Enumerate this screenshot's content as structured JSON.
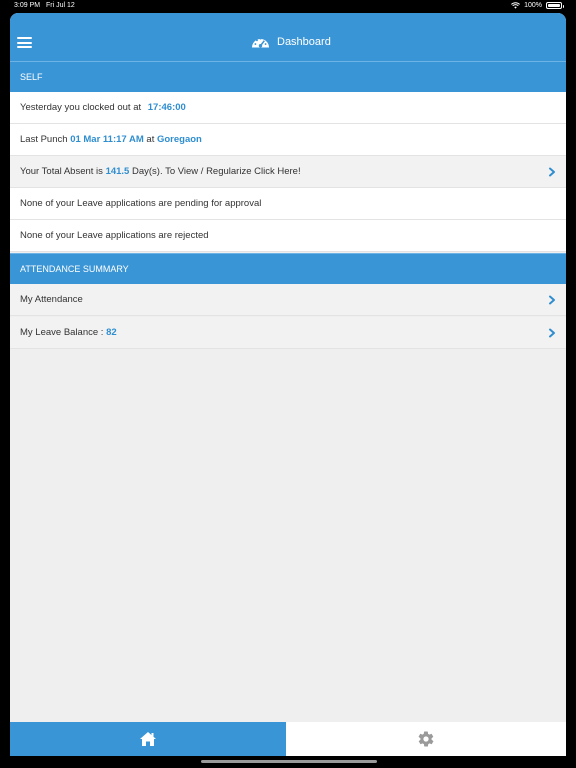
{
  "status_bar": {
    "time": "3:09 PM",
    "date": "Fri Jul 12",
    "battery": "100%"
  },
  "header": {
    "title": "Dashboard"
  },
  "self_section": {
    "title": "SELF",
    "clock_out_prefix": "Yesterday you clocked out at",
    "clock_out_time": "17:46:00",
    "last_punch_prefix": "Last Punch",
    "last_punch_datetime": "01 Mar 11:17 AM",
    "last_punch_at": "at",
    "last_punch_location": "Goregaon",
    "absent_prefix": "Your Total Absent is",
    "absent_days": "141.5",
    "absent_suffix": "Day(s). To View / Regularize Click Here!",
    "leave_pending": "None of your Leave applications are pending for approval",
    "leave_rejected": "None of your Leave applications are rejected"
  },
  "attendance_section": {
    "title": "ATTENDANCE SUMMARY",
    "my_attendance": "My Attendance",
    "leave_balance_label": "My Leave Balance :",
    "leave_balance_value": "82"
  },
  "tabbar": {
    "home_icon": "home-icon",
    "settings_icon": "gear-icon"
  },
  "colors": {
    "primary": "#3a95d6",
    "highlight": "#2f8ed0",
    "background": "#efefef"
  }
}
